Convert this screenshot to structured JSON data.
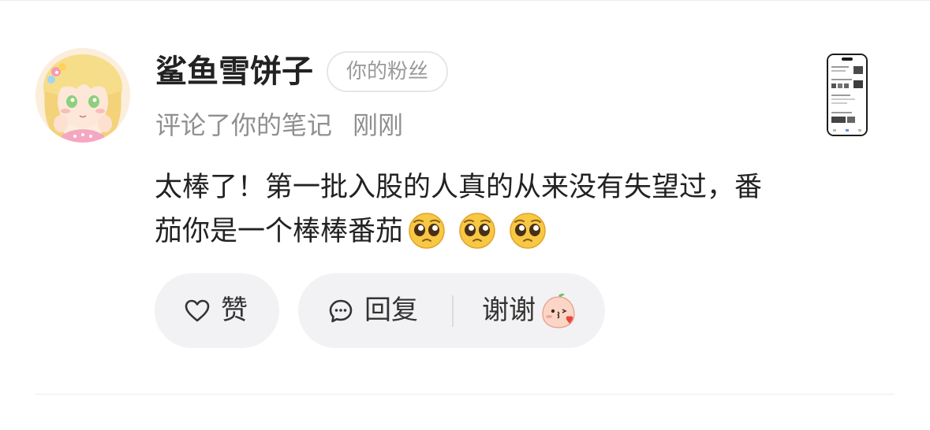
{
  "notification": {
    "username": "鲨鱼雪饼子",
    "badge": "你的粉丝",
    "action": "评论了你的笔记",
    "time": "刚刚",
    "comment_text": "太棒了！第一批入股的人真的从来没有失望过，番茄你是一个棒棒番茄",
    "comment_emojis": [
      "pleading-face",
      "pleading-face",
      "pleading-face"
    ]
  },
  "actions": {
    "like_label": "赞",
    "reply_label": "回复",
    "thanks_label": "谢谢"
  },
  "colors": {
    "pill_background": "#f2f2f4",
    "primary_text": "#222222",
    "secondary_text": "#8f8f8f",
    "emoji_yellow": "#f7b935"
  },
  "icons": {
    "like": "heart-outline-icon",
    "reply": "chat-bubble-icon",
    "thanks": "peach-sticker-icon"
  }
}
